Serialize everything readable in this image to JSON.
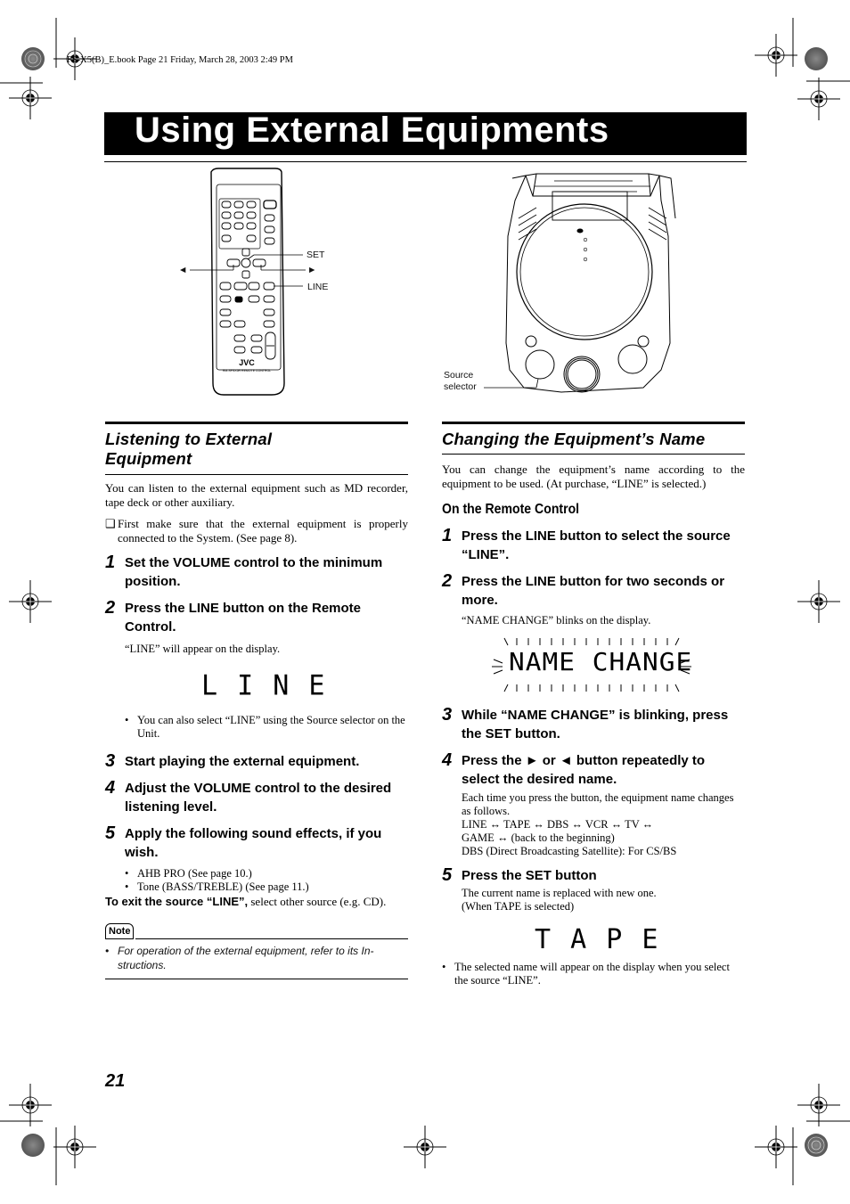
{
  "book_meta": "FS-X5(B)_E.book  Page 21  Friday, March 28, 2003  2:49 PM",
  "page_title": "Using External Equipments",
  "figures": {
    "remote": {
      "brand": "JVC",
      "model_label": "RM-SFSX5R REMOTE CONTROL",
      "callouts": {
        "set": "SET",
        "line": "LINE"
      },
      "arrows": {
        "left": "◄",
        "right": "►"
      }
    },
    "unit": {
      "callouts": {
        "source_selector": [
          "Source",
          "selector"
        ]
      }
    }
  },
  "left_section": {
    "heading": [
      "Listening to External",
      "Equipment"
    ],
    "intro": "You can listen to the external equipment such as MD re­corder, tape deck or other auxiliary.",
    "checkbox_note": "First make sure that the external equipment is properly connected to the System. (See page 8).",
    "steps": [
      {
        "num": "1",
        "text": "Set the VOLUME control to the mini­mum position."
      },
      {
        "num": "2",
        "text": "Press the LINE button on the Remote Control.",
        "detail": "“LINE” will appear on the display."
      },
      {
        "num": "3",
        "text": "Start playing the external equipment."
      },
      {
        "num": "4",
        "text": "Adjust the VOLUME control to the desired listening level."
      },
      {
        "num": "5",
        "text": "Apply the following sound effects, if you wish."
      }
    ],
    "display_line": "L I N E",
    "display_bullet": "You can also select “LINE” using the Source selector on the Unit.",
    "effects": [
      "AHB PRO (See page 10.)",
      "Tone (BASS/TREBLE) (See page 11.)"
    ],
    "exit_bold": "To exit the source “LINE”,",
    "exit_rest": " select other source (e.g. CD).",
    "note_label": "Note",
    "note_text": "For operation of the external equipment, refer to its In­structions."
  },
  "right_section": {
    "heading": "Changing the Equipment’s Name",
    "intro": "You can change the equipment’s name according to the equipment to be used. (At purchase, “LINE” is selected.)",
    "subheading": "On the Remote Control",
    "steps": [
      {
        "num": "1",
        "text": "Press the LINE button to select the source “LINE”."
      },
      {
        "num": "2",
        "text": "Press the LINE button for two seconds or more.",
        "detail": "“NAME CHANGE” blinks on the display."
      },
      {
        "num": "3",
        "text": "While “NAME CHANGE” is blinking, press the SET button."
      },
      {
        "num": "4",
        "text": "Press the ► or ◄ button repeatedly to select the desired name."
      },
      {
        "num": "5",
        "text": "Press the SET button"
      }
    ],
    "display_name_change": "NAME CHANGE",
    "step4_detail": "Each time you press the button, the equipment name changes as follows.",
    "name_cycle": [
      "LINE",
      "TAPE",
      "DBS",
      "VCR",
      "TV",
      "GAME"
    ],
    "cycle_arrow": "↔",
    "cycle_end": "(back to the beginning)",
    "dbs_note": "DBS (Direct Broadcasting Satellite): For CS/BS",
    "step5_detail": [
      "The current name is replaced with new one.",
      "(When TAPE is selected)"
    ],
    "display_tape": "T A P E",
    "final_bullet": "The selected name will appear on the display when you select the source “LINE”."
  },
  "page_number": "21"
}
